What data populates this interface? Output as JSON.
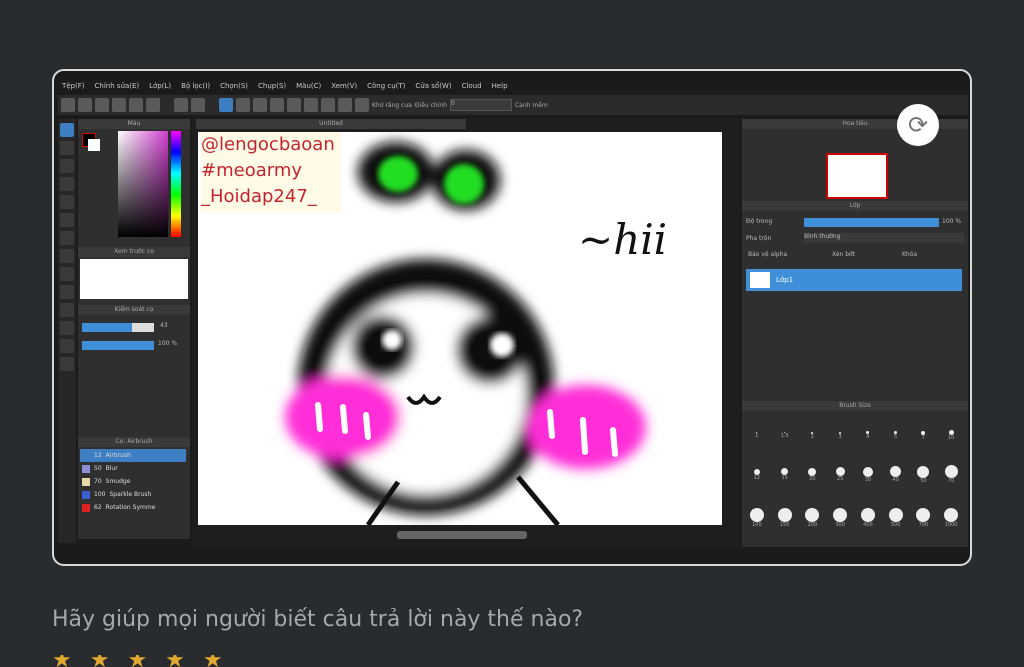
{
  "app": {
    "menu": [
      "Tệp(F)",
      "Chỉnh sửa(E)",
      "Lớp(L)",
      "Bộ lọc(I)",
      "Chọn(S)",
      "Chụp(S)",
      "Màu(C)",
      "Xem(V)",
      "Công cụ(T)",
      "Cửa sổ(W)",
      "Cloud",
      "Help"
    ],
    "toolbar_label_snap": "Khử răng cưa",
    "toolbar_label_correction": "Điều chỉnh",
    "toolbar_correction_value": "0",
    "toolbar_label_edge": "Cạnh mềm",
    "canvas_tab": "Untitled",
    "watermark": [
      "@lengocbaoan",
      "#meoarmy",
      "_Hoidap247_"
    ],
    "handwriting": "~hii",
    "left": {
      "color_header": "Màu",
      "brush_preview_header": "Xem trước cọ",
      "brush_settings_header": "Kiểm soát cọ",
      "size_value": "43",
      "opacity_value": "100 %",
      "brush_header": "Cọ: Airbrush",
      "brushes": [
        {
          "size": "12",
          "name": "Airbrush",
          "color": "#3e7fc4"
        },
        {
          "size": "50",
          "name": "Blur",
          "color": "#8f8fd8"
        },
        {
          "size": "70",
          "name": "Smudge",
          "color": "#e8d8a8"
        },
        {
          "size": "100",
          "name": "Sparkle Brush",
          "color": "#3a5fcf"
        },
        {
          "size": "62",
          "name": "Rotation Symme",
          "color": "#d22"
        }
      ]
    },
    "right": {
      "navigator_header": "Hoa tiêu",
      "layer_header": "Lớp",
      "opacity_label": "Độ trong",
      "opacity_value": "100 %",
      "blend_label": "Pha trộn",
      "blend_value": "Bình thường",
      "cb_protect": "Bảo vệ alpha",
      "cb_clip": "Xén bớt",
      "cb_lock": "Khóa",
      "layer_name": "Lớp1",
      "brush_size_header": "Brush Size",
      "brush_sizes": [
        "1",
        "1.5",
        "2",
        "3",
        "4",
        "5",
        "7",
        "10",
        "12",
        "15",
        "20",
        "25",
        "30",
        "40",
        "50",
        "70",
        "100",
        "150",
        "200",
        "300",
        "400",
        "500",
        "700",
        "1000"
      ]
    }
  },
  "caption": "Hãy giúp mọi người biết câu trả lời này thế nào?",
  "stars": "★★★★★",
  "colors": {
    "accent": "#3e7fc4",
    "watermark": "#c4242f",
    "blush": "#ff2fd8",
    "eyes": "#22dd22"
  }
}
